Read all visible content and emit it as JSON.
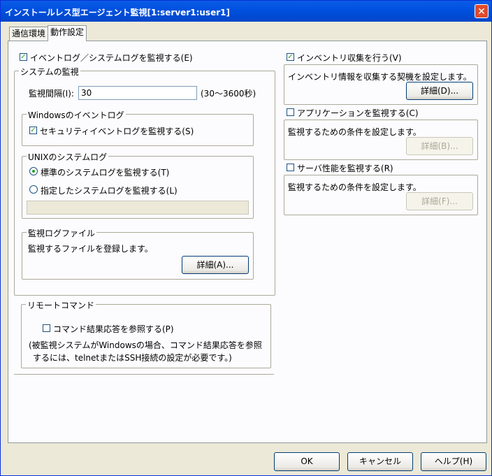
{
  "window": {
    "title": "インストールレス型エージェント監視[1:server1:user1]",
    "close_glyph": "✕"
  },
  "tabs": [
    {
      "label": "通信環境"
    },
    {
      "label": "動作設定"
    }
  ],
  "log_monitor": {
    "checkbox_label": "イベントログ／システムログを監視する(E)",
    "checked": true,
    "system_group": {
      "title": "システムの監視",
      "interval_label": "監視間隔(I):",
      "interval_value": "30",
      "interval_hint": "(30～3600秒)",
      "windows_group": {
        "title": "Windowsのイベントログ",
        "security_label": "セキュリティイベントログを監視する(S)",
        "security_checked": true
      },
      "unix_group": {
        "title": "UNIXのシステムログ",
        "standard_label": "標準のシステムログを監視する(T)",
        "specified_label": "指定したシステムログを監視する(L)",
        "selected": "standard",
        "path_value": ""
      },
      "file_group": {
        "title": "監視ログファイル",
        "description": "監視するファイルを登録します。",
        "details_button": "詳細(A)..."
      }
    },
    "remote_group": {
      "title": "リモートコマンド",
      "checkbox_label": "コマンド結果応答を参照する(P)",
      "checked": false,
      "note_line1": "(被監視システムがWindowsの場合、コマンド結果応答を参照",
      "note_line2": "するには、telnetまたはSSH接続の設定が必要です。)"
    }
  },
  "inventory": {
    "checkbox_label": "インベントリ収集を行う(V)",
    "checked": true,
    "description": "インベントリ情報を収集する契機を設定します。",
    "details_button": "詳細(D)..."
  },
  "application": {
    "checkbox_label": "アプリケーションを監視する(C)",
    "checked": false,
    "description": "監視するための条件を設定します。",
    "details_button": "詳細(B)..."
  },
  "server_performance": {
    "checkbox_label": "サーバ性能を監視する(R)",
    "checked": false,
    "description": "監視するための条件を設定します。",
    "details_button": "詳細(F)..."
  },
  "footer": {
    "ok": "OK",
    "cancel": "キャンセル",
    "help": "ヘルプ(H)"
  }
}
